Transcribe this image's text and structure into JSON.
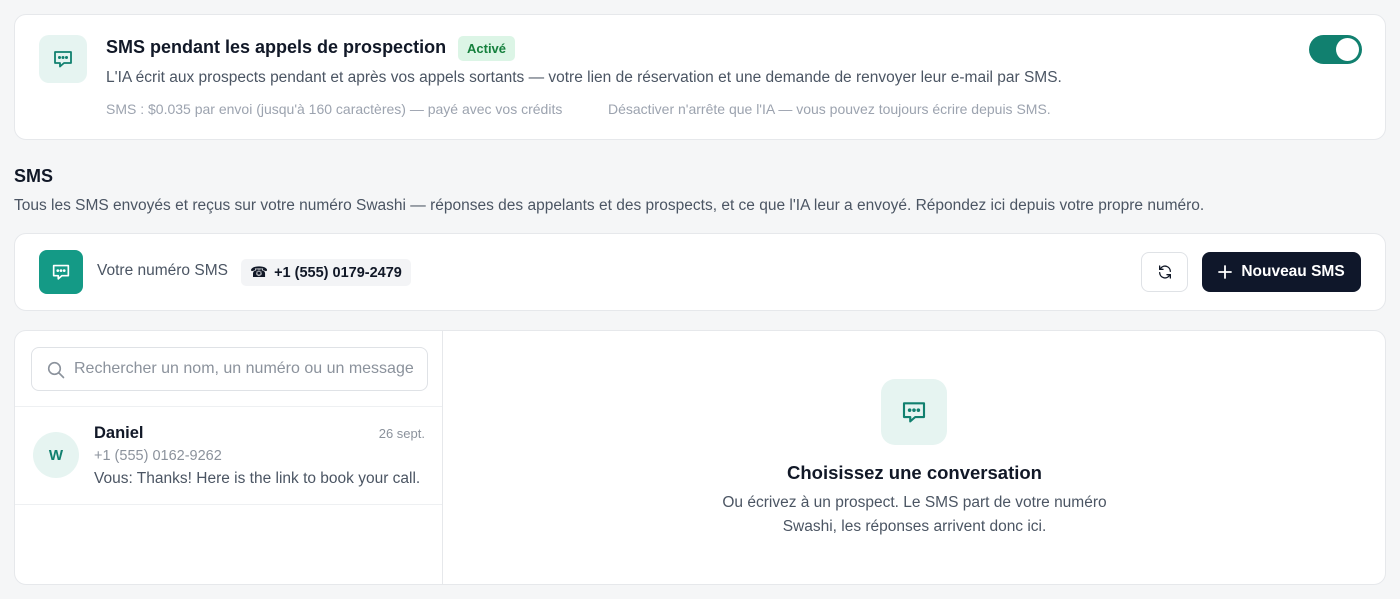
{
  "feature": {
    "icon": "chat-bubble-icon",
    "title": "SMS pendant les appels de prospection",
    "status_badge": "Activé",
    "description": "L'IA écrit aux prospects pendant et après vos appels sortants — votre lien de réservation et une demande de renvoyer leur e-mail par SMS.",
    "pricing_note": "SMS : $0.035 par envoi (jusqu'à 160 caractères) — payé avec vos crédits",
    "disable_note": "Désactiver n'arrête que l'IA — vous pouvez toujours écrire depuis SMS.",
    "enabled": true,
    "accent_color": "#11806f"
  },
  "section": {
    "title": "SMS",
    "subtitle": "Tous les SMS envoyés et reçus sur votre numéro Swashi — réponses des appelants et des prospects, et ce que l'IA leur a envoyé. Répondez ici depuis votre propre numéro."
  },
  "number_bar": {
    "icon": "chat-bubble-icon",
    "label": "Votre numéro SMS",
    "phone_icon": "☎",
    "phone": "+1 (555) 0179-2479",
    "refresh_icon": "refresh-icon",
    "new_sms_label": "Nouveau SMS"
  },
  "search": {
    "placeholder": "Rechercher un nom, un numéro ou un message",
    "value": ""
  },
  "conversations": [
    {
      "initial": "W",
      "name": "Daniel",
      "date": "26 sept.",
      "phone": "+1 (555) 0162-9262",
      "preview": "Vous: Thanks! Here is the link to book your call."
    }
  ],
  "empty_state": {
    "icon": "chat-bubble-icon",
    "title": "Choisissez une conversation",
    "line1": "Ou écrivez à un prospect. Le SMS part de votre numéro",
    "line2": "Swashi, les réponses arrivent donc ici."
  }
}
